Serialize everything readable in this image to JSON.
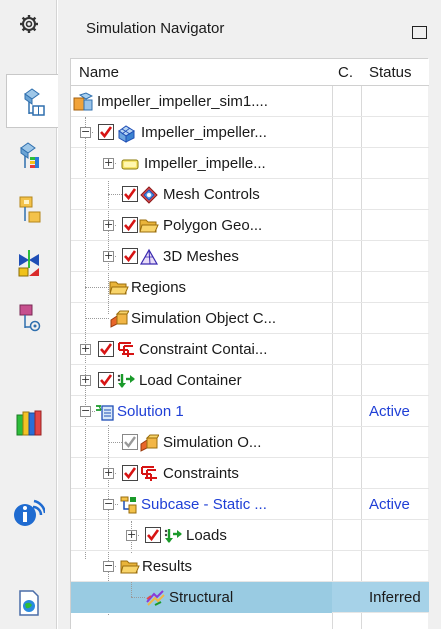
{
  "panel": {
    "title": "Simulation Navigator"
  },
  "columns": {
    "name": "Name",
    "c": "C.",
    "status": "Status"
  },
  "rows": [
    {
      "label": "Impeller_impeller_sim1....",
      "status": ""
    },
    {
      "label": "Impeller_impeller...",
      "status": ""
    },
    {
      "label": "Impeller_impelle...",
      "status": ""
    },
    {
      "label": "Mesh Controls",
      "status": ""
    },
    {
      "label": "Polygon Geo...",
      "status": ""
    },
    {
      "label": "3D Meshes",
      "status": ""
    },
    {
      "label": "Regions",
      "status": ""
    },
    {
      "label": "Simulation Object C...",
      "status": ""
    },
    {
      "label": "Constraint Contai...",
      "status": ""
    },
    {
      "label": "Load Container",
      "status": ""
    },
    {
      "label": "Solution 1",
      "status": "Active"
    },
    {
      "label": "Simulation O...",
      "status": ""
    },
    {
      "label": "Constraints",
      "status": ""
    },
    {
      "label": "Subcase - Static ...",
      "status": "Active"
    },
    {
      "label": "Loads",
      "status": ""
    },
    {
      "label": "Results",
      "status": ""
    },
    {
      "label": "Structural",
      "status": "Inferred"
    }
  ],
  "icons": {
    "sidebar": [
      "gear-icon",
      "part-navigator-icon",
      "assembly-navigator-icon",
      "constraint-navigator-icon",
      "reuse-library-icon",
      "hd3d-tools-icon",
      "roles-icon",
      "history-icon",
      "web-browser-icon",
      "system-materials-icon"
    ]
  },
  "colors": {
    "active_status": "#1f3fd6",
    "selection": "#a6d2e8",
    "checkbox_red": "#d71414"
  }
}
